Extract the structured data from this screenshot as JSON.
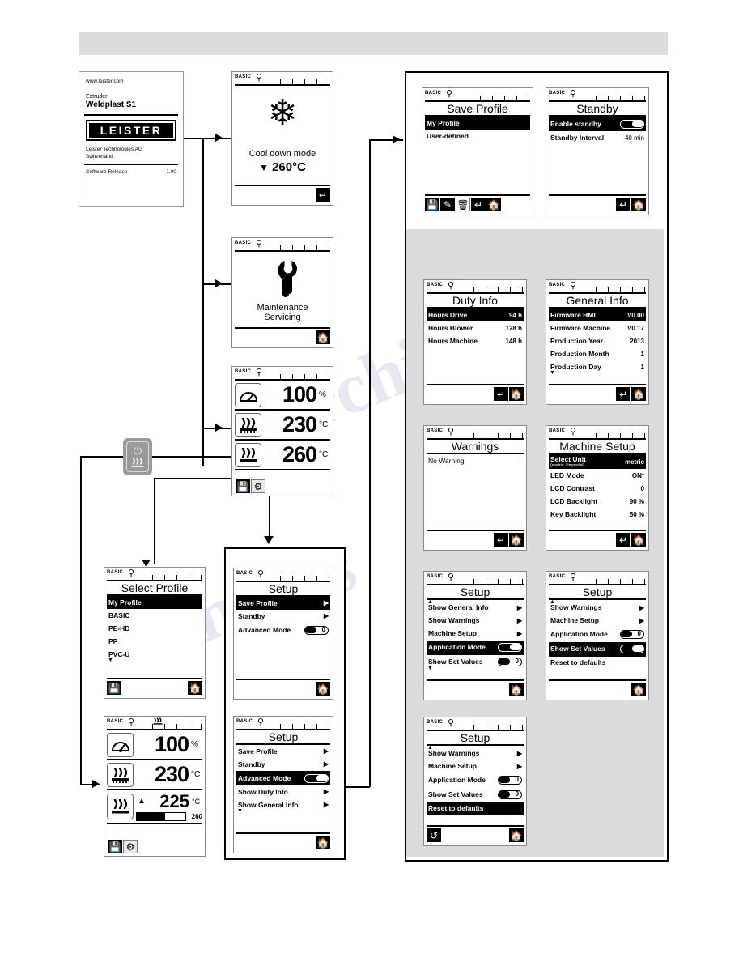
{
  "page": {
    "header_band_color": "#dcdcdc",
    "panel_gray": "#dcdcdc"
  },
  "splash": {
    "url": "www.leister.com",
    "category": "Extruder",
    "model": "Weldplast S1",
    "logo": "LEISTER",
    "company_line1": "Leister Technologies AG",
    "company_line2": "Switzerland",
    "software_label": "Software Release",
    "software_value": "1.00"
  },
  "statusbar": {
    "mode": "BASIC",
    "no_load_icon": "no-load-icon",
    "heat_icon": "heating-icon"
  },
  "cooldown": {
    "icon": "snowflake-icon",
    "label": "Cool down mode",
    "arrow": "▼",
    "value": "260°C",
    "footer": {
      "back": "back-icon"
    }
  },
  "maintenance": {
    "icon": "wrench-icon",
    "line1": "Maintenance",
    "line2": "Servicing",
    "footer": {
      "home": "home-icon"
    }
  },
  "main_screen": {
    "rows": [
      {
        "icon": "speed-gauge-icon",
        "value": "100",
        "unit": "%"
      },
      {
        "icon": "blower-heat-icon",
        "value": "230",
        "unit": "°C"
      },
      {
        "icon": "heater-icon",
        "value": "260",
        "unit": "°C"
      }
    ],
    "footer": {
      "save": "save-profile-icon",
      "setup": "gears-setup-icon"
    }
  },
  "main_screen_adv": {
    "rows": [
      {
        "icon": "speed-gauge-icon",
        "value": "100",
        "unit": "%"
      },
      {
        "icon": "blower-heat-icon",
        "value": "230",
        "unit": "°C"
      },
      {
        "icon": "heater-icon",
        "value": "225",
        "unit": "°C",
        "target": "260",
        "mark": "▲"
      }
    ],
    "footer": {
      "save": "save-profile-icon",
      "setup": "gears-setup-icon"
    }
  },
  "select_profile": {
    "title": "Select Profile",
    "items": [
      {
        "label": "My Profile",
        "selected": true
      },
      {
        "label": "BASIC",
        "selected": false
      },
      {
        "label": "PE-HD",
        "selected": false
      },
      {
        "label": "PP",
        "selected": false
      },
      {
        "label": "PVC-U",
        "selected": false
      }
    ],
    "scroll_down": "▼",
    "footer": {
      "save": "save-profile-icon",
      "home": "home-icon"
    }
  },
  "setup_basic": {
    "title": "Setup",
    "items": [
      {
        "label": "Save Profile",
        "type": "submenu",
        "selected": true
      },
      {
        "label": "Standby",
        "type": "submenu",
        "selected": false
      },
      {
        "label": "Advanced Mode",
        "type": "toggle",
        "state": "off",
        "selected": false
      }
    ],
    "footer": {
      "home": "home-icon"
    }
  },
  "setup_advanced": {
    "title": "Setup",
    "items": [
      {
        "label": "Save Profile",
        "type": "submenu",
        "selected": false
      },
      {
        "label": "Standby",
        "type": "submenu",
        "selected": false
      },
      {
        "label": "Advanced Mode",
        "type": "toggle",
        "state": "on",
        "selected": true
      },
      {
        "label": "Show Duty Info",
        "type": "submenu",
        "selected": false
      },
      {
        "label": "Show General Info",
        "type": "submenu",
        "selected": false
      }
    ],
    "scroll_down": "▼",
    "footer": {
      "home": "home-icon"
    }
  },
  "save_profile": {
    "title": "Save Profile",
    "items": [
      {
        "label": "My Profile",
        "selected": true
      },
      {
        "label": "User-defined",
        "selected": false
      }
    ],
    "footer": {
      "save": "save-icon",
      "rename": "rename-icon",
      "delete": "trash-icon",
      "back": "back-icon",
      "home": "home-icon"
    }
  },
  "standby": {
    "title": "Standby",
    "items": [
      {
        "label": "Enable standby",
        "type": "toggle",
        "state": "on",
        "selected": true
      },
      {
        "label": "Standby Interval",
        "type": "value",
        "value": "40 min",
        "selected": false
      }
    ],
    "footer": {
      "back": "back-icon",
      "home": "home-icon"
    }
  },
  "duty_info": {
    "title": "Duty Info",
    "items": [
      {
        "label": "Hours Drive",
        "value": "94 h",
        "selected": true
      },
      {
        "label": "Hours Blower",
        "value": "128 h",
        "selected": false
      },
      {
        "label": "Hours Machine",
        "value": "148 h",
        "selected": false
      }
    ],
    "footer": {
      "back": "back-icon",
      "home": "home-icon"
    }
  },
  "general_info": {
    "title": "General Info",
    "items": [
      {
        "label": "Firmware HMI",
        "value": "V0.00",
        "selected": true
      },
      {
        "label": "Firmware Machine",
        "value": "V0.17",
        "selected": false
      },
      {
        "label": "Production Year",
        "value": "2013",
        "selected": false
      },
      {
        "label": "Production Month",
        "value": "1",
        "selected": false
      },
      {
        "label": "Production Day",
        "value": "1",
        "selected": false
      }
    ],
    "scroll_down": "▼",
    "footer": {
      "back": "back-icon",
      "home": "home-icon"
    }
  },
  "warnings": {
    "title": "Warnings",
    "message": "No Warning",
    "footer": {
      "back": "back-icon",
      "home": "home-icon"
    }
  },
  "machine_setup": {
    "title": "Machine Setup",
    "items": [
      {
        "label": "Select Unit",
        "sub": "(metric / imperial)",
        "value": "metric",
        "selected": true
      },
      {
        "label": "LED Mode",
        "value": "ON*",
        "selected": false
      },
      {
        "label": "LCD Contrast",
        "value": "0",
        "selected": false
      },
      {
        "label": "LCD Backlight",
        "value": "90 %",
        "selected": false
      },
      {
        "label": "Key Backlight",
        "value": "50 %",
        "selected": false
      }
    ],
    "footer": {
      "back": "back-icon",
      "home": "home-icon"
    }
  },
  "setup_scroll_a": {
    "title": "Setup",
    "scroll_up": "▲",
    "items": [
      {
        "label": "Show General Info",
        "type": "submenu",
        "selected": false
      },
      {
        "label": "Show Warnings",
        "type": "submenu",
        "selected": false
      },
      {
        "label": "Machine Setup",
        "type": "submenu",
        "selected": false
      },
      {
        "label": "Application Mode",
        "type": "toggle",
        "state": "on",
        "selected": true
      },
      {
        "label": "Show Set Values",
        "type": "toggle",
        "state": "off",
        "selected": false
      }
    ],
    "scroll_down": "▼",
    "footer": {
      "home": "home-icon"
    }
  },
  "setup_scroll_b": {
    "title": "Setup",
    "scroll_up": "▲",
    "items": [
      {
        "label": "Show Warnings",
        "type": "submenu",
        "selected": false
      },
      {
        "label": "Machine Setup",
        "type": "submenu",
        "selected": false
      },
      {
        "label": "Application Mode",
        "type": "toggle",
        "state": "off",
        "selected": false
      },
      {
        "label": "Show Set Values",
        "type": "toggle",
        "state": "on",
        "selected": true
      },
      {
        "label": "Reset to defaults",
        "type": "action",
        "selected": false
      }
    ],
    "footer": {
      "home": "home-icon"
    }
  },
  "setup_scroll_c": {
    "title": "Setup",
    "scroll_up": "▲",
    "items": [
      {
        "label": "Show Warnings",
        "type": "submenu",
        "selected": false
      },
      {
        "label": "Machine Setup",
        "type": "submenu",
        "selected": false
      },
      {
        "label": "Application Mode",
        "type": "toggle",
        "state": "off",
        "selected": false
      },
      {
        "label": "Show Set Values",
        "type": "toggle",
        "state": "off",
        "selected": false
      },
      {
        "label": "Reset to defaults",
        "type": "action",
        "selected": true
      }
    ],
    "footer": {
      "reset": "reset-icon",
      "home": "home-icon"
    }
  },
  "power_key": {
    "name": "power-heat-key",
    "power_glyph": "⏻",
    "heat_glyph": "heating-icon"
  }
}
